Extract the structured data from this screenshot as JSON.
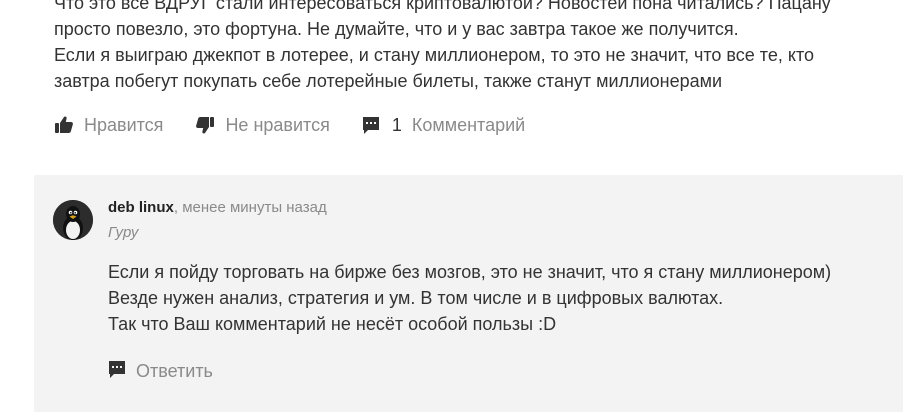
{
  "post": {
    "lines": [
      "Что это все ВДРУГ стали интересоваться криптовалютой? Новостей пона читались? Пацану",
      "просто повезло, это фортуна. Не думайте, что и у вас завтра такое же получится.",
      "Если я выиграю джекпот в лотерее, и стану миллионером, то это не значит, что все те, кто",
      "завтра побегут покупать себе лотерейные билеты, также станут миллионерами"
    ]
  },
  "actions": {
    "like_label": "Нравится",
    "dislike_label": "Не нравится",
    "comments_count": "1",
    "comments_label": "Комментарий"
  },
  "comment": {
    "author": "deb linux",
    "separator": ",",
    "time": "менее минуты назад",
    "rank": "Гуру",
    "lines": [
      "Если я пойду торговать на бирже без мозгов, это не значит, что я стану миллионером)",
      "Везде нужен анализ, стратегия и ум. В том числе и в цифровых валютах.",
      "Так что Ваш комментарий не несёт особой пользы :D"
    ],
    "reply_label": "Ответить"
  },
  "colors": {
    "text": "#333333",
    "muted": "#8a8a8a",
    "comment_bg": "#f3f3f3",
    "icon": "#333333"
  }
}
